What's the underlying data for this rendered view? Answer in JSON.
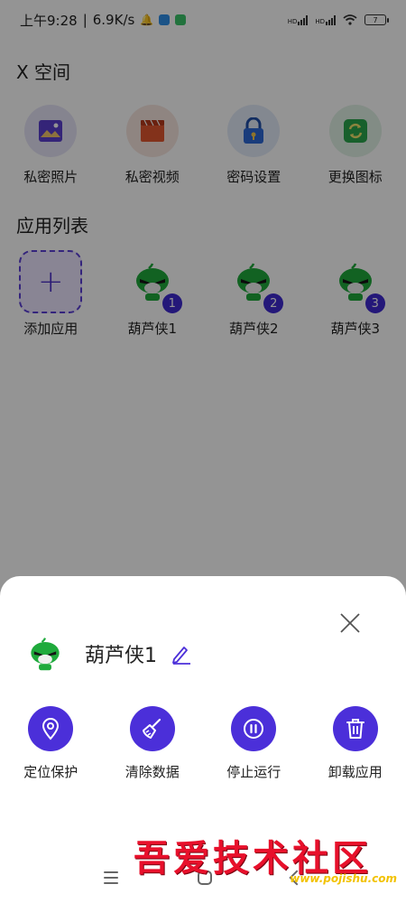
{
  "status_bar": {
    "time": "上午9:28",
    "speed": "6.9K/s",
    "net1": "HD",
    "net2": "HD",
    "battery": "7"
  },
  "sections": {
    "x_space_title": "X 空间",
    "app_list_title": "应用列表"
  },
  "features": [
    {
      "label": "私密照片",
      "icon": "photo-icon",
      "color": "#5a3fcf"
    },
    {
      "label": "私密视频",
      "icon": "video-icon",
      "color": "#e2572f"
    },
    {
      "label": "密码设置",
      "icon": "lock-icon",
      "color": "#2c68d6"
    },
    {
      "label": "更换图标",
      "icon": "swap-icon",
      "color": "#2aa64d"
    }
  ],
  "apps": {
    "add_label": "添加应用",
    "add_symbol": "+",
    "items": [
      {
        "name": "葫芦侠1",
        "badge": "1"
      },
      {
        "name": "葫芦侠2",
        "badge": "2"
      },
      {
        "name": "葫芦侠3",
        "badge": "3"
      }
    ]
  },
  "sheet": {
    "app_name": "葫芦侠1",
    "actions": [
      {
        "label": "定位保护",
        "icon": "location-pin-icon"
      },
      {
        "label": "清除数据",
        "icon": "broom-icon"
      },
      {
        "label": "停止运行",
        "icon": "pause-icon"
      },
      {
        "label": "卸载应用",
        "icon": "trash-icon"
      }
    ]
  },
  "watermark": {
    "text": "吾爱技术社区",
    "url": "www.pojishu.com"
  },
  "colors": {
    "accent": "#4b2fd9",
    "overlay": "rgba(0,0,0,0.42)"
  }
}
